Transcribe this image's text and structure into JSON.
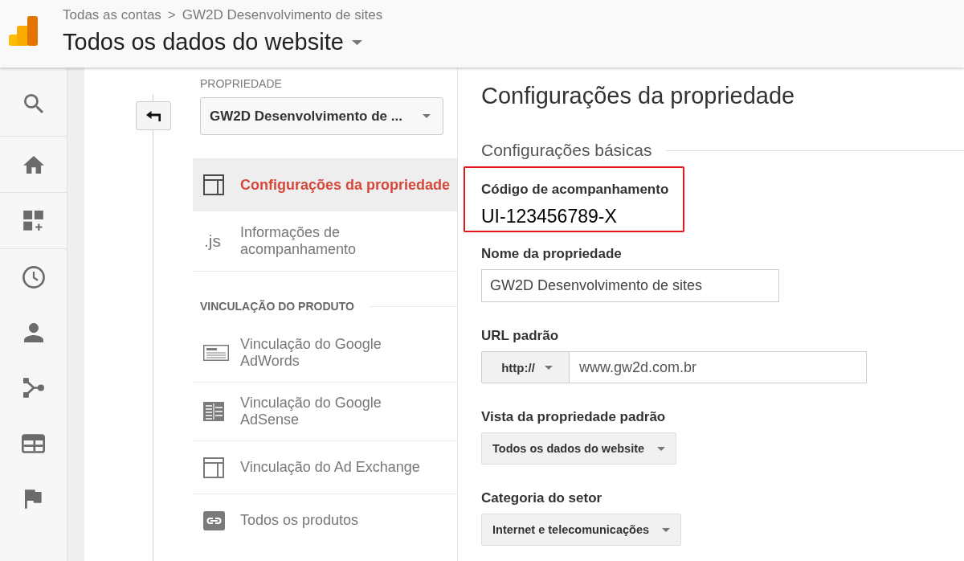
{
  "header": {
    "breadcrumb": [
      {
        "label": "Todas as contas"
      },
      {
        "label": "GW2D Desenvolvimento de sites"
      }
    ],
    "separator": ">",
    "view_selector": "Todos os dados do website"
  },
  "rail": {
    "groups": [
      {
        "items": [
          {
            "kind": "search",
            "selected": false
          }
        ]
      },
      {
        "items": [
          {
            "kind": "home",
            "selected": false
          }
        ]
      },
      {
        "items": [
          {
            "kind": "tiles",
            "selected": false
          }
        ]
      },
      {
        "items": [
          {
            "kind": "clock",
            "selected": false
          },
          {
            "kind": "person",
            "selected": false
          },
          {
            "kind": "fork",
            "selected": false
          },
          {
            "kind": "panel",
            "selected": false
          },
          {
            "kind": "flag",
            "selected": false
          }
        ]
      }
    ]
  },
  "property_column": {
    "label": "PROPRIEDADE",
    "selector": "GW2D Desenvolvimento de ...",
    "items": [
      {
        "kind": "layout",
        "label": "Configurações da propriedade",
        "selected": true
      },
      {
        "kind": "script",
        "icon_text": ".js",
        "label": "Informações de acompanhamento",
        "selected": false
      }
    ],
    "sections": [
      {
        "title": "VINCULAÇÃO DO PRODUTO",
        "items": [
          {
            "kind": "article",
            "label": "Vinculação do Google AdWords",
            "selected": false
          },
          {
            "kind": "grid",
            "label": "Vinculação do Google AdSense",
            "selected": false
          },
          {
            "kind": "layout",
            "label": "Vinculação do Ad Exchange",
            "selected": false
          },
          {
            "kind": "link",
            "label": "Todos os produtos",
            "selected": false
          }
        ]
      }
    ]
  },
  "settings": {
    "title": "Configurações da propriedade",
    "section": "Configurações básicas",
    "tracking": {
      "label": "Código de acompanhamento",
      "value": "UI-123456789-X",
      "highlighted": true
    },
    "fields": [
      {
        "kind": "text",
        "label": "Nome da propriedade",
        "value": "GW2D Desenvolvimento de sites"
      },
      {
        "kind": "url",
        "label": "URL padrão",
        "protocol": "http://",
        "value": "www.gw2d.com.br"
      },
      {
        "kind": "select",
        "label": "Vista da propriedade padrão",
        "value": "Todos os dados do website"
      },
      {
        "kind": "select",
        "label": "Categoria do setor",
        "value": "Internet e telecomunicações"
      }
    ]
  }
}
